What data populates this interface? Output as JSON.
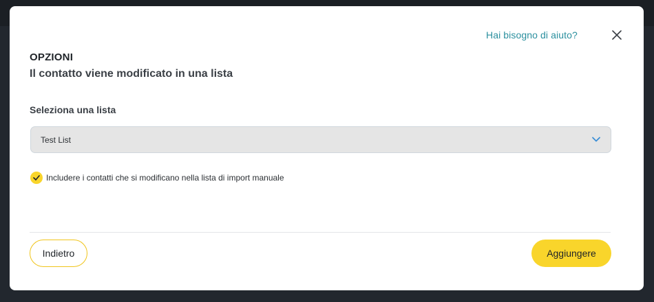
{
  "modal": {
    "help_link": "Hai bisogno di aiuto?",
    "close_icon": "close-icon",
    "title": "OPZIONI",
    "subtitle": "Il contatto viene modificato in una lista",
    "select": {
      "label": "Seleziona una lista",
      "value": "Test List",
      "icon": "chevron-down-icon"
    },
    "checkbox": {
      "checked": true,
      "label": "Includere i contatti che si modificano nella lista di import manuale",
      "icon": "check-icon"
    },
    "buttons": {
      "back": "Indietro",
      "add": "Aggiungere"
    }
  },
  "colors": {
    "accent_yellow": "#f9d52b",
    "link_teal": "#2a8f9e",
    "chevron_blue": "#3b8fd6",
    "backdrop": "#22272e"
  }
}
